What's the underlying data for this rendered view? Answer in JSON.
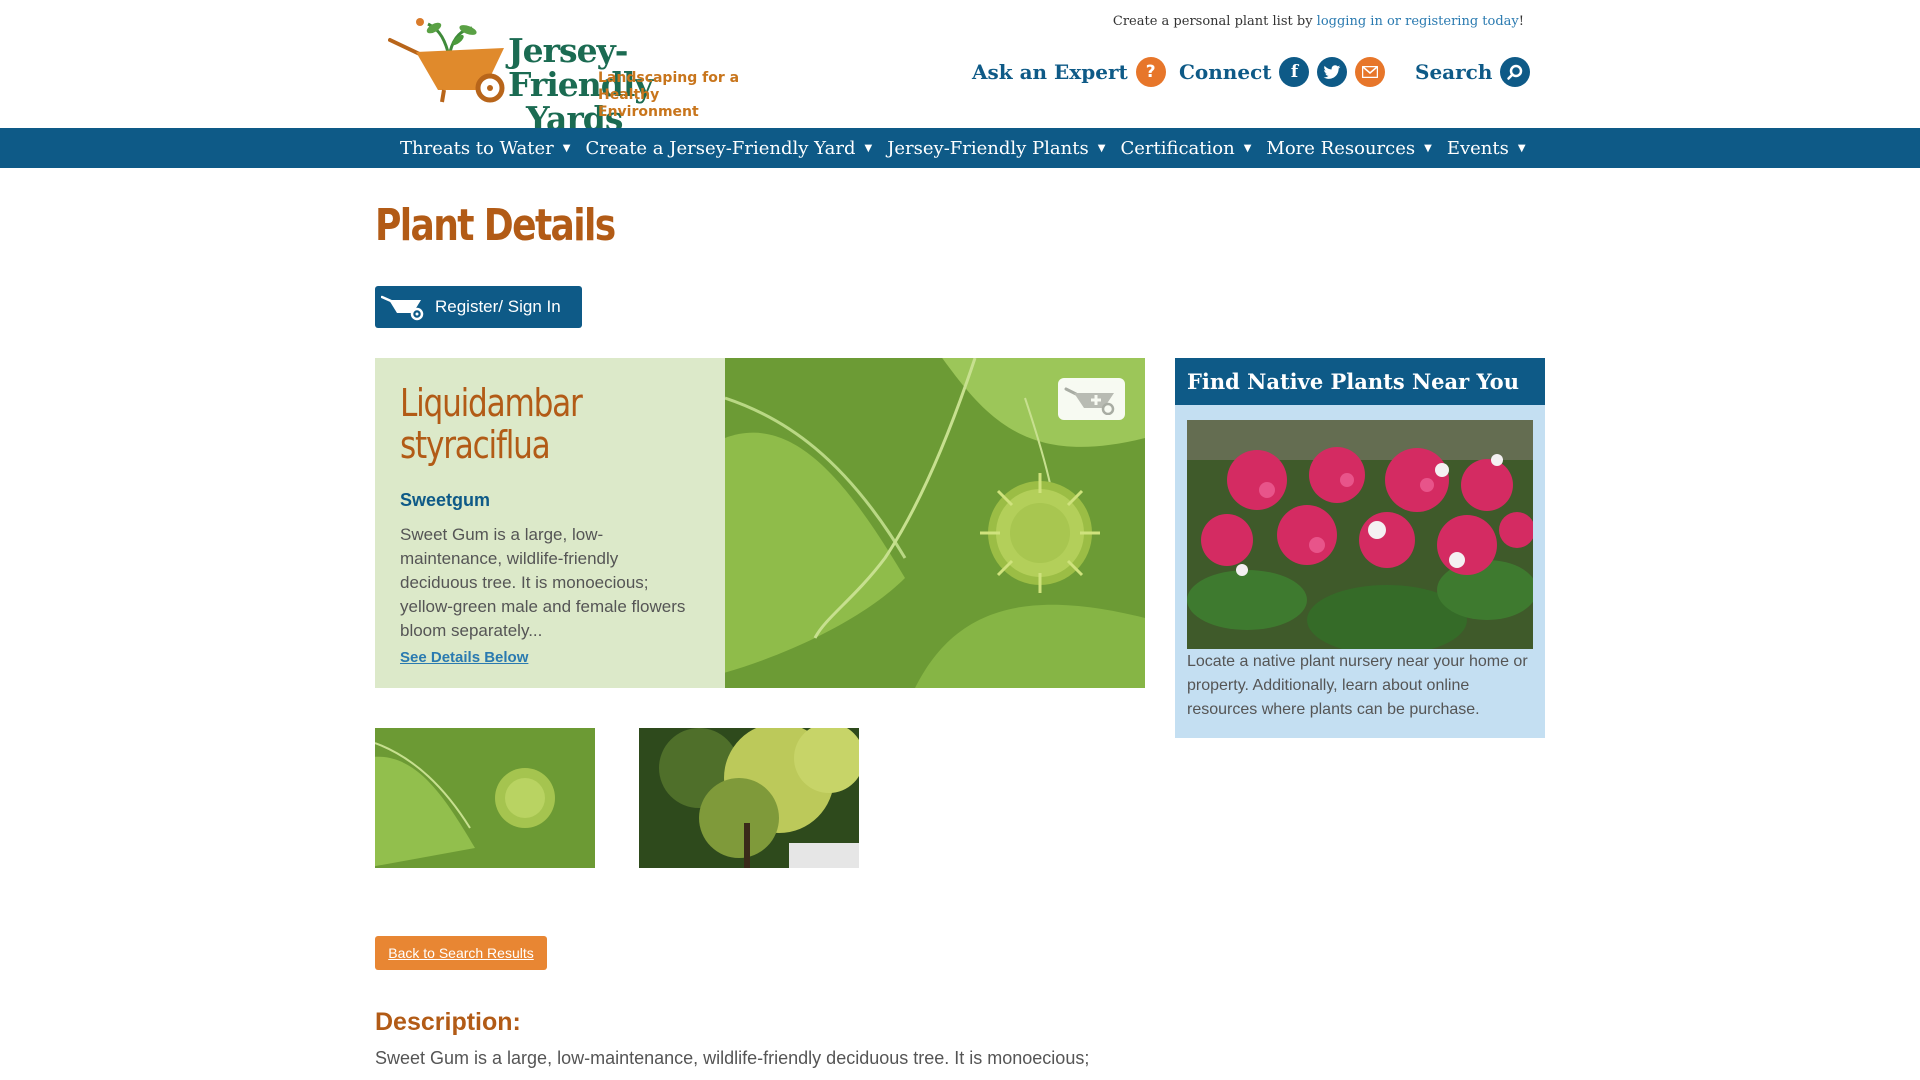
{
  "header": {
    "logo": {
      "title_line1": "Jersey-Friendly",
      "title_line2": "Yards",
      "tagline_line1": "Landscaping for a",
      "tagline_line2": "Healthy Environment"
    },
    "util_prefix": "Create a personal plant list by ",
    "util_link": "logging in or registering today",
    "util_suffix": "!",
    "ask_expert": "Ask an Expert",
    "connect": "Connect",
    "search": "Search",
    "icons": {
      "ask": "question-icon",
      "facebook": "facebook-icon",
      "twitter": "twitter-icon",
      "email": "email-icon",
      "search": "search-icon"
    }
  },
  "nav": {
    "items": [
      {
        "label": "Threats to Water"
      },
      {
        "label": "Create a Jersey-Friendly Yard"
      },
      {
        "label": "Jersey-Friendly Plants"
      },
      {
        "label": "Certification"
      },
      {
        "label": "More Resources"
      },
      {
        "label": "Events"
      }
    ]
  },
  "main": {
    "page_title": "Plant Details",
    "register_button": "Register/ Sign In",
    "plant": {
      "scientific_name": "Liquidambar styraciflua",
      "common_name": "Sweetgum",
      "short_description": "Sweet Gum is a large, low-maintenance, wildlife-friendly deciduous tree. It is monoecious; yellow-green male and female flowers bloom separately...",
      "see_details": "See Details Below"
    },
    "back_button": "Back to Search Results",
    "description_heading": "Description:",
    "description_text": "Sweet Gum is a large, low-maintenance, wildlife-friendly deciduous tree. It is monoecious;"
  },
  "sidebar": {
    "heading": "Find Native Plants Near You",
    "text": "Locate a native plant nursery near your home or property. Additionally, learn about online resources where plants can be purchase."
  },
  "colors": {
    "brand_blue": "#0e5a87",
    "brand_orange": "#e7762a",
    "title_brown": "#b25b16",
    "card_green": "#dce9c9",
    "sidebar_blue": "#c4dff2"
  }
}
